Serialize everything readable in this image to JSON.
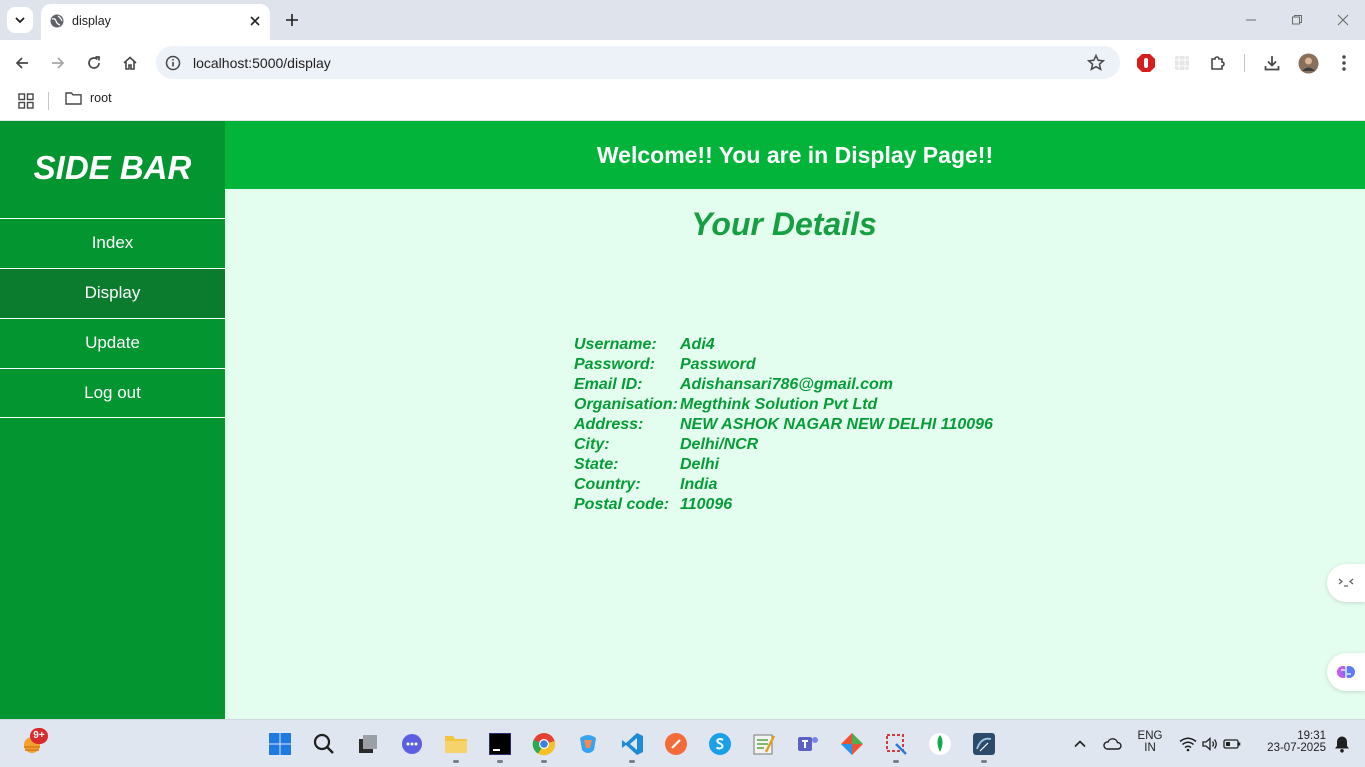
{
  "browser": {
    "tab_title": "display",
    "url": "localhost:5000/display",
    "bookmark_folder": "root"
  },
  "sidebar": {
    "title": "SIDE BAR",
    "items": [
      {
        "label": "Index",
        "active": false
      },
      {
        "label": "Display",
        "active": true
      },
      {
        "label": "Update",
        "active": false
      },
      {
        "label": "Log out",
        "active": false
      }
    ]
  },
  "header": {
    "welcome": "Welcome!! You are in Display Page!!"
  },
  "details": {
    "title": "Your Details",
    "rows": [
      {
        "label": "Username:",
        "value": "Adi4"
      },
      {
        "label": "Password:",
        "value": "Password"
      },
      {
        "label": "Email ID:",
        "value": "Adishansari786@gmail.com"
      },
      {
        "label": "Organisation:",
        "value": "Megthink Solution Pvt Ltd"
      },
      {
        "label": "Address:",
        "value": "NEW ASHOK NAGAR NEW DELHI 110096"
      },
      {
        "label": "City:",
        "value": "Delhi/NCR"
      },
      {
        "label": "State:",
        "value": "Delhi"
      },
      {
        "label": "Country:",
        "value": "India"
      },
      {
        "label": "Postal code:",
        "value": "110096"
      }
    ]
  },
  "taskbar": {
    "notification_badge": "9+",
    "language_line1": "ENG",
    "language_line2": "IN",
    "time": "19:31",
    "date": "23-07-2025"
  },
  "colors": {
    "sidebar_bg": "#03952f",
    "sidebar_active": "#0b7c2d",
    "header_bg": "#03b43a",
    "content_bg": "#e3fdee",
    "text_green": "#069c36"
  }
}
